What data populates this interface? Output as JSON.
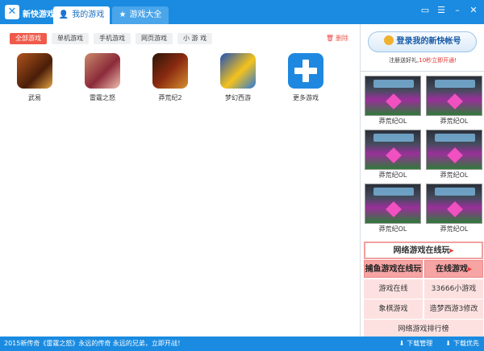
{
  "app": {
    "title": "新快游戏"
  },
  "tabs": [
    {
      "label": "我的游戏"
    },
    {
      "label": "游戏大全"
    }
  ],
  "filters": [
    {
      "label": "全部游戏"
    },
    {
      "label": "单机游戏"
    },
    {
      "label": "手机游戏"
    },
    {
      "label": "网页游戏"
    },
    {
      "label": "小 游 戏"
    }
  ],
  "delete_label": "删除",
  "games": [
    {
      "name": "武易"
    },
    {
      "name": "雷霆之怒"
    },
    {
      "name": "莽荒纪2"
    },
    {
      "name": "梦幻西游"
    },
    {
      "name": "更多游戏"
    }
  ],
  "sidebar": {
    "login_label": "登录我的新快帐号",
    "register_prefix": "注册送好礼,",
    "register_link": "10秒立即开通!",
    "thumbs": [
      {
        "name": "莽荒纪OL"
      },
      {
        "name": "莽荒纪OL"
      },
      {
        "name": "莽荒纪OL"
      },
      {
        "name": "莽荒纪OL"
      },
      {
        "name": "莽荒纪OL"
      },
      {
        "name": "莽荒纪OL"
      }
    ],
    "links": {
      "online_title": "网络游戏在线玩",
      "fish": "捕鱼游戏在线玩",
      "online_game": "在线游戏",
      "game_online": "游戏在线",
      "small_33666": "33666小游戏",
      "chess": "象棋游戏",
      "mod": "造梦西游3修改",
      "ranking": "网络游戏排行榜"
    }
  },
  "statusbar": {
    "text": "2015新传奇《雷霆之怒》永远的传奇 永远的兄弟，立即开战！",
    "download_manage": "下载管理",
    "download_priority": "下载优先"
  },
  "colors": {
    "accent": "#1a8be0",
    "active_filter": "#ef5a4b"
  }
}
